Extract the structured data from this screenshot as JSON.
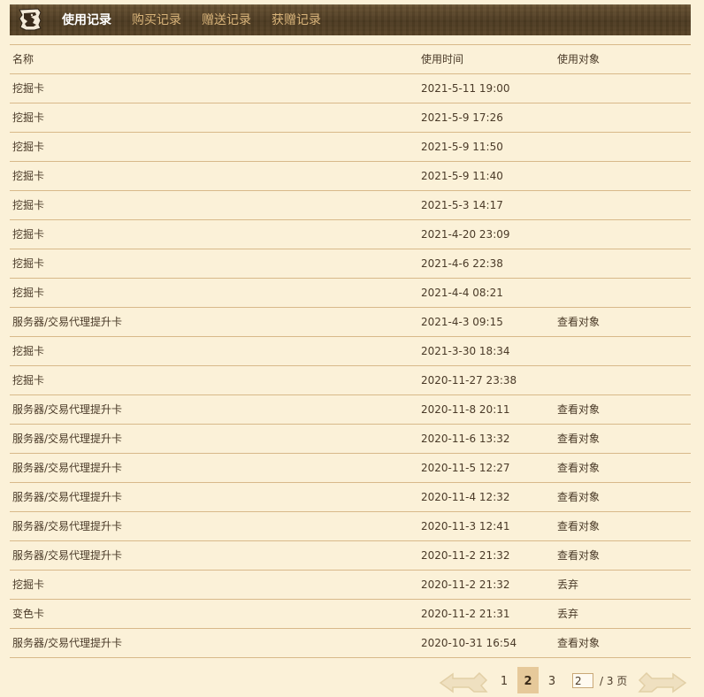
{
  "tabs": [
    {
      "label": "使用记录",
      "active": true
    },
    {
      "label": "购买记录",
      "active": false
    },
    {
      "label": "赠送记录",
      "active": false
    },
    {
      "label": "获赠记录",
      "active": false
    }
  ],
  "table": {
    "headers": {
      "name": "名称",
      "time": "使用时间",
      "target": "使用对象"
    },
    "rows": [
      {
        "name": "挖掘卡",
        "time": "2021-5-11 19:00",
        "target": ""
      },
      {
        "name": "挖掘卡",
        "time": "2021-5-9 17:26",
        "target": ""
      },
      {
        "name": "挖掘卡",
        "time": "2021-5-9 11:50",
        "target": ""
      },
      {
        "name": "挖掘卡",
        "time": "2021-5-9 11:40",
        "target": ""
      },
      {
        "name": "挖掘卡",
        "time": "2021-5-3 14:17",
        "target": ""
      },
      {
        "name": "挖掘卡",
        "time": "2021-4-20 23:09",
        "target": ""
      },
      {
        "name": "挖掘卡",
        "time": "2021-4-6 22:38",
        "target": ""
      },
      {
        "name": "挖掘卡",
        "time": "2021-4-4 08:21",
        "target": ""
      },
      {
        "name": "服务器/交易代理提升卡",
        "time": "2021-4-3 09:15",
        "target": "查看对象"
      },
      {
        "name": "挖掘卡",
        "time": "2021-3-30 18:34",
        "target": ""
      },
      {
        "name": "挖掘卡",
        "time": "2020-11-27 23:38",
        "target": ""
      },
      {
        "name": "服务器/交易代理提升卡",
        "time": "2020-11-8 20:11",
        "target": "查看对象"
      },
      {
        "name": "服务器/交易代理提升卡",
        "time": "2020-11-6 13:32",
        "target": "查看对象"
      },
      {
        "name": "服务器/交易代理提升卡",
        "time": "2020-11-5 12:27",
        "target": "查看对象"
      },
      {
        "name": "服务器/交易代理提升卡",
        "time": "2020-11-4 12:32",
        "target": "查看对象"
      },
      {
        "name": "服务器/交易代理提升卡",
        "time": "2020-11-3 12:41",
        "target": "查看对象"
      },
      {
        "name": "服务器/交易代理提升卡",
        "time": "2020-11-2 21:32",
        "target": "查看对象"
      },
      {
        "name": "挖掘卡",
        "time": "2020-11-2 21:32",
        "target": "丢弃"
      },
      {
        "name": "变色卡",
        "time": "2020-11-2 21:31",
        "target": "丢弃"
      },
      {
        "name": "服务器/交易代理提升卡",
        "time": "2020-10-31 16:54",
        "target": "查看对象"
      }
    ]
  },
  "pagination": {
    "pages": [
      "1",
      "2",
      "3"
    ],
    "current": "2",
    "input_value": "2",
    "total_label": "/ 3 页"
  },
  "colors": {
    "background": "#fbf1d8",
    "tabbar": "#5a4629",
    "tab_active": "#ffffff",
    "tab_inactive": "#d9b47a",
    "row_border": "#d8b98a",
    "current_page_bg": "#e6c99a"
  },
  "icons": {
    "logo": "horse-knight-logo-icon",
    "prev": "prev-arrow-icon",
    "next": "next-arrow-icon"
  }
}
